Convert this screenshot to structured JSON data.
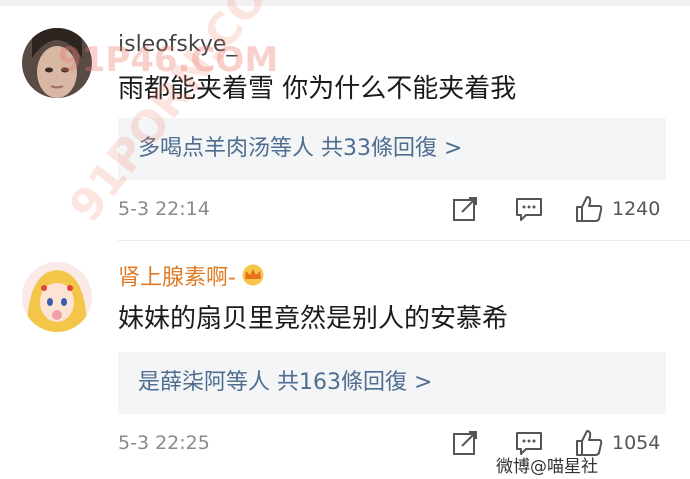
{
  "comments": [
    {
      "username": "isleofskye_",
      "text": "雨都能夹着雪 你为什么不能夹着我",
      "replies_text": "多喝点羊肉汤等人 共33條回復 >",
      "time": "5-3 22:14",
      "likes": "1240"
    },
    {
      "username": "肾上腺素啊-",
      "text": "妹妹的扇贝里竟然是别人的安慕希",
      "replies_text": "是薛柒阿等人 共163條回復 >",
      "time": "5-3 22:25",
      "likes": "1054"
    }
  ],
  "watermark": "微博@喵星社",
  "overlay_marks": [
    "91P46.COM",
    "91PORN.COM"
  ],
  "colors": {
    "reply_link": "#4e6d8f",
    "username_vip": "#e07a25",
    "reply_bg": "#f4f5f7"
  },
  "icons": [
    "share-icon",
    "comment-icon",
    "like-icon",
    "crown-icon"
  ]
}
